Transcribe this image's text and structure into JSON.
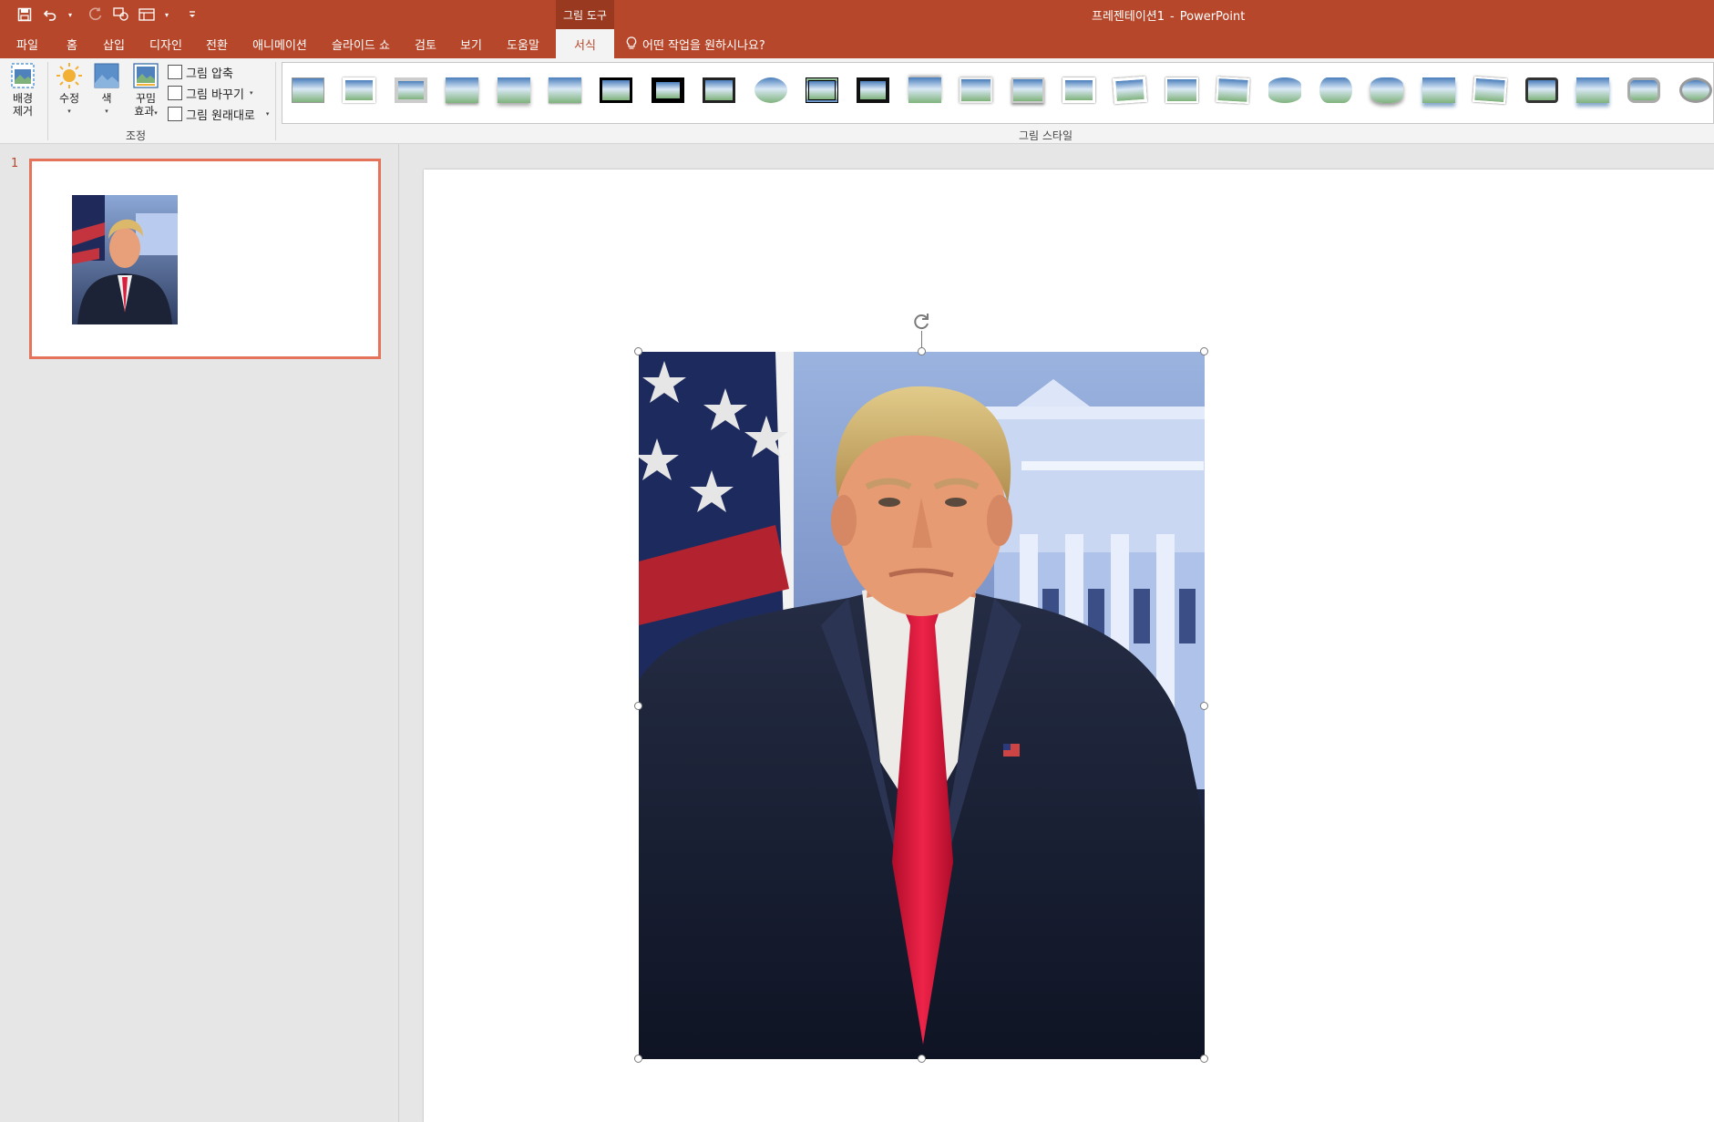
{
  "titlebar": {
    "context_tab": "그림 도구",
    "document_name": "프레젠테이션1",
    "separator": "-",
    "app_name": "PowerPoint"
  },
  "quick_access": [
    "save-icon",
    "undo-icon",
    "redo-icon",
    "touch-mode-icon",
    "layout-icon",
    "customize-icon"
  ],
  "tabs": [
    {
      "label": "파일"
    },
    {
      "label": "홈"
    },
    {
      "label": "삽입"
    },
    {
      "label": "디자인"
    },
    {
      "label": "전환"
    },
    {
      "label": "애니메이션"
    },
    {
      "label": "슬라이드 쇼"
    },
    {
      "label": "검토"
    },
    {
      "label": "보기"
    },
    {
      "label": "도움말"
    },
    {
      "label": "서식",
      "active": true
    }
  ],
  "tell_me": "어떤 작업을 원하시나요?",
  "ribbon": {
    "remove_bg": {
      "line1": "배경",
      "line2": "제거"
    },
    "corrections": "수정",
    "color": "색",
    "artistic": {
      "line1": "꾸밈",
      "line2": "효과"
    },
    "compress": "그림 압축",
    "change": "그림 바꾸기",
    "reset": "그림 원래대로",
    "adjust_group": "조정",
    "styles_group": "그림 스타일",
    "style_count": 28
  },
  "thumbnails": {
    "slide_number": "1"
  },
  "colors": {
    "accent": "#b7472a",
    "accent_dark": "#99391f",
    "ribbon_bg": "#f3f3f3",
    "selection": "#e5735a"
  }
}
